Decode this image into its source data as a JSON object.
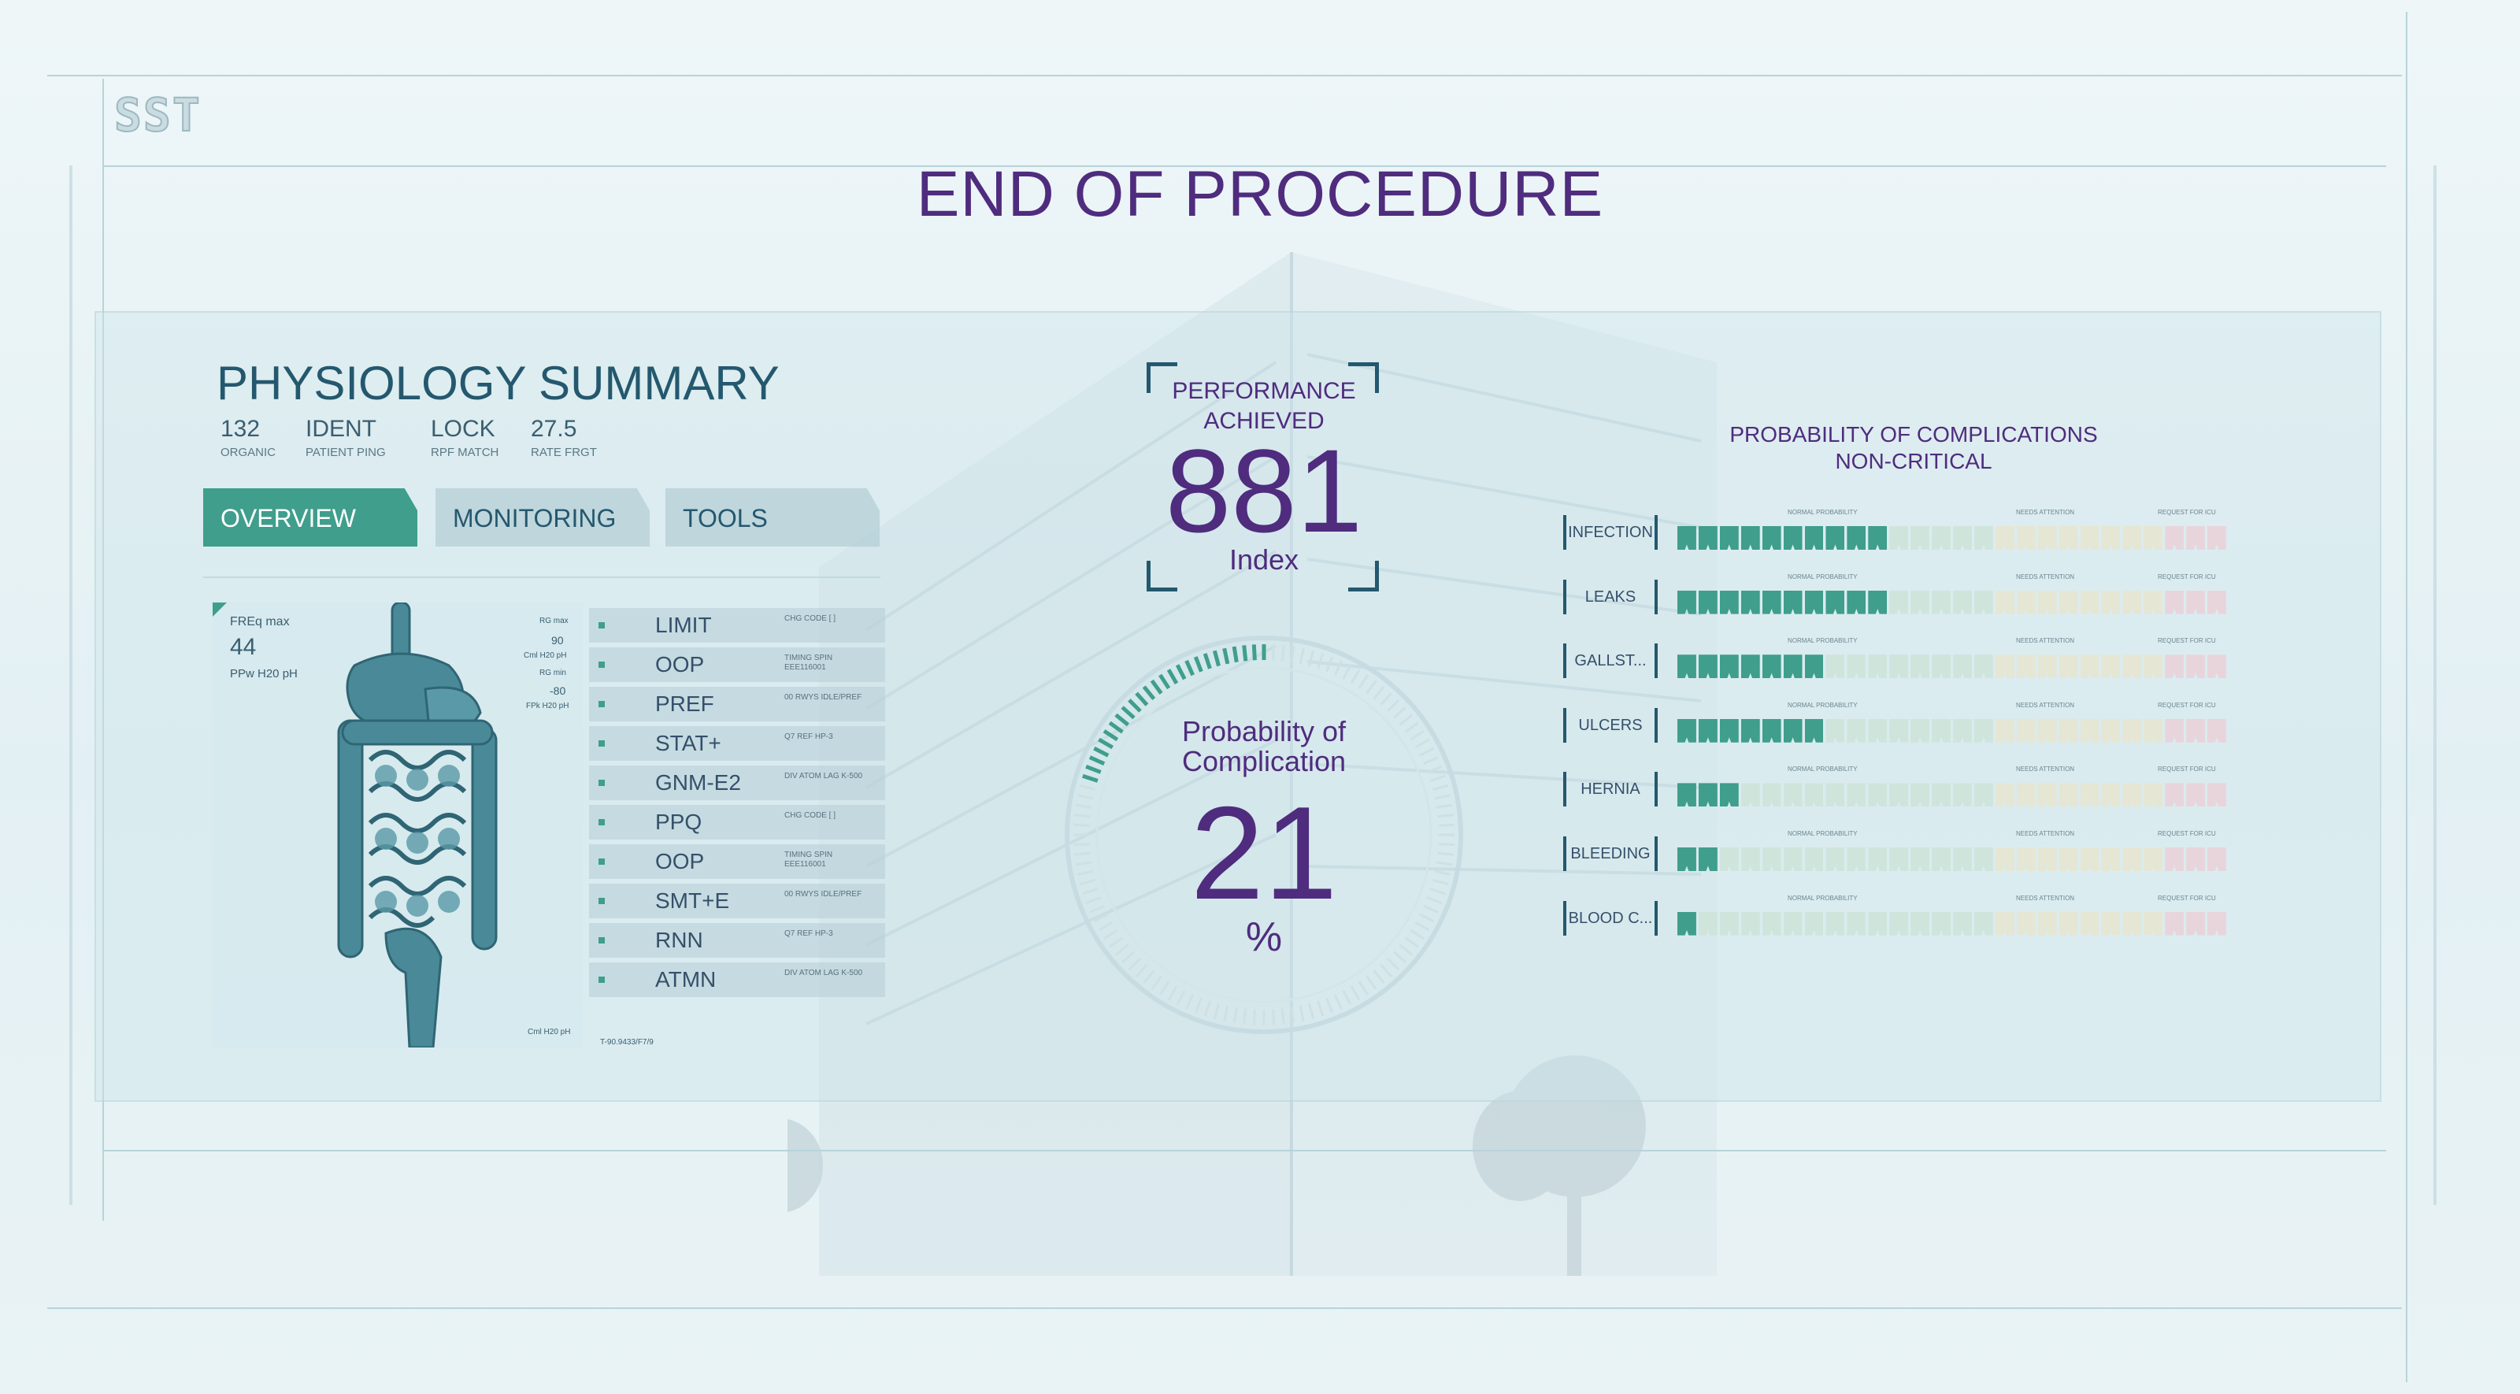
{
  "logo": {
    "text": "SST"
  },
  "title": "END OF PROCEDURE",
  "physiology": {
    "title": "PHYSIOLOGY SUMMARY",
    "stats": [
      {
        "value": "132",
        "label": "ORGANIC"
      },
      {
        "value": "IDENT",
        "label": "PATIENT PING"
      },
      {
        "value": "LOCK",
        "label": "RPF MATCH"
      },
      {
        "value": "27.5",
        "label": "RATE FRGT"
      }
    ],
    "tabs": [
      {
        "label": "OVERVIEW",
        "active": true
      },
      {
        "label": "MONITORING",
        "active": false
      },
      {
        "label": "TOOLS",
        "active": false
      }
    ],
    "organ_panel": {
      "freq_label": "FREq max",
      "freq_value": "44",
      "ppw_label": "PPw H20 pH",
      "right_labels": [
        "RG max",
        "90",
        "Cml H20 pH",
        "RG min",
        "-80",
        "FPk H20 pH"
      ],
      "bottom_label": "Cml H20 pH"
    },
    "list": [
      {
        "name": "LIMIT",
        "code": "CHG CODE [ ]"
      },
      {
        "name": "OOP",
        "code": "TIMING SPIN EEE116001"
      },
      {
        "name": "PREF",
        "code": "00 RWYS IDLE/PREF"
      },
      {
        "name": "STAT+",
        "code": "Q7 REF HP-3"
      },
      {
        "name": "GNM-E2",
        "code": "DIV ATOM LAG K-500"
      },
      {
        "name": "PPQ",
        "code": "CHG CODE [ ]"
      },
      {
        "name": "OOP",
        "code": "TIMING SPIN EEE116001"
      },
      {
        "name": "SMT+E",
        "code": "00 RWYS IDLE/PREF"
      },
      {
        "name": "RNN",
        "code": "Q7 REF HP-3"
      },
      {
        "name": "ATMN",
        "code": "DIV ATOM LAG K-500"
      }
    ],
    "list_footer": "T-90.9433/F7/9"
  },
  "performance": {
    "label_line1": "PERFORMANCE",
    "label_line2": "ACHIEVED",
    "value": "881",
    "unit": "Index"
  },
  "probability": {
    "label_line1": "Probability of",
    "label_line2": "Complication",
    "value": "21",
    "unit": "%",
    "fraction": 0.21
  },
  "complications": {
    "title_line1": "PROBABILITY OF COMPLICATIONS",
    "title_line2": "NON-CRITICAL",
    "zone_labels": [
      "NORMAL PROBABILITY",
      "NEEDS ATTENTION",
      "REQUEST FOR ICU"
    ],
    "total_segments": 26,
    "items": [
      {
        "label": "INFECTION",
        "filled": 10
      },
      {
        "label": "LEAKS",
        "filled": 10
      },
      {
        "label": "GALLST...",
        "filled": 7
      },
      {
        "label": "ULCERS",
        "filled": 7
      },
      {
        "label": "HERNIA",
        "filled": 3
      },
      {
        "label": "BLEEDING",
        "filled": 2
      },
      {
        "label": "BLOOD C...",
        "filled": 1
      }
    ]
  },
  "colors": {
    "accent": "#3f9e8c",
    "title": "#4f2c7e",
    "dark_teal": "#24586e",
    "normal_zone": "#cfe5dc",
    "attention_zone": "#e5e6d3",
    "icu_zone": "#e8d5dc"
  }
}
